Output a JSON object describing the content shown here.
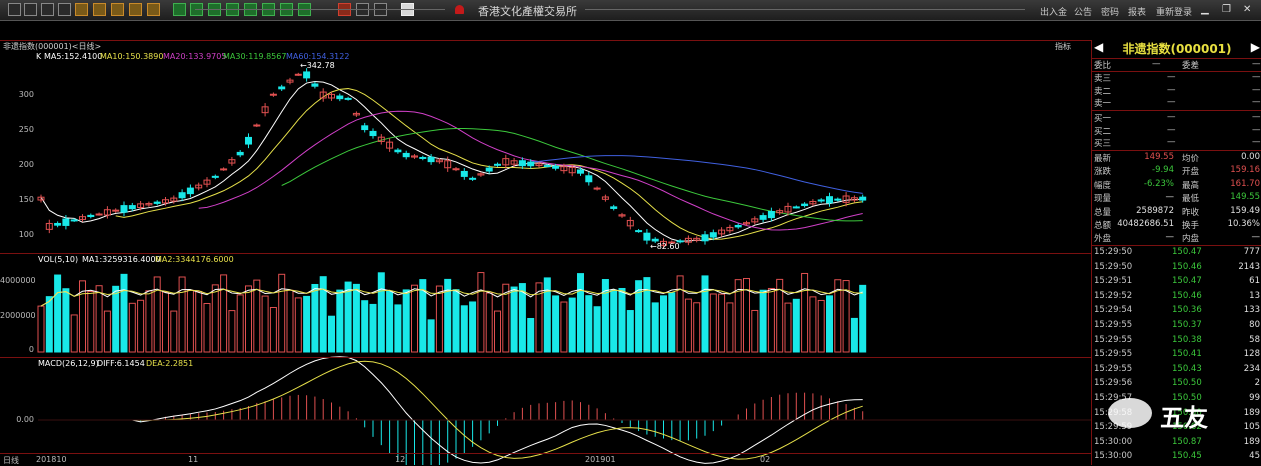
{
  "window": {
    "title": "香港文化產權交易所",
    "menu": [
      "出入金",
      "公告",
      "密码",
      "报表",
      "重新登录"
    ],
    "toolbar_icons": [
      "chart-icon",
      "line-icon",
      "bar-icon",
      "table-icon",
      "select-icon",
      "tool-icon",
      "tool-icon",
      "tool-icon",
      "tool-icon",
      "green-icon",
      "green-icon",
      "green-icon",
      "green-icon",
      "green-icon",
      "green-icon",
      "green-icon",
      "green-icon",
      "report-icon",
      "zoom-in-icon",
      "zoom-out-icon",
      "note-icon"
    ]
  },
  "chart": {
    "header": "非遗指数(000001)<日线>",
    "ma_labels": {
      "k": "K",
      "ma5": "MA5:152.4100",
      "ma10": "MA10:150.3890",
      "ma20": "MA20:133.9705",
      "ma30": "MA30:119.8567",
      "ma60": "MA60:154.3122"
    },
    "tab": "指标",
    "high_mark": "342.78",
    "low_mark": "82.60",
    "vol_label": "VOL(5,10)",
    "vol_ma1": "MA1:3259316.4000",
    "vol_ma2": "MA2:3344176.6000",
    "macd_label": "MACD(26,12,9)",
    "macd_diff": "DIFF:6.1454",
    "macd_dea": "DEA:2.2851",
    "price_ticks": [
      "300",
      "250",
      "200",
      "150",
      "100"
    ],
    "vol_ticks": [
      "4000000",
      "2000000",
      "0"
    ],
    "macd_ticks": [
      "0.00"
    ],
    "x_ticks": [
      "日线",
      "201810",
      "11",
      "12",
      "201901",
      "02"
    ],
    "colors": {
      "up": "#e05050",
      "down": "#19e8e8",
      "ma5": "#ffffff",
      "ma10": "#e6e04a",
      "ma20": "#d040c8",
      "ma30": "#3cc83c",
      "ma60": "#4060e0"
    }
  },
  "chart_data": {
    "type": "candlestick",
    "price_ylim": [
      82.6,
      342.78
    ],
    "note_points": {
      "high": 342.78,
      "low": 82.6
    },
    "volume_ma": {
      "MA1": 3259316.4,
      "MA2": 3344176.6
    },
    "macd": {
      "DIFF": 6.1454,
      "DEA": 2.2851
    }
  },
  "quote": {
    "title": "非遗指数(000001)",
    "weibi": {
      "l1": "委比",
      "v1": "—",
      "l2": "委差",
      "v2": "—"
    },
    "asks": [
      {
        "label": "卖三",
        "p": "—",
        "v": "—"
      },
      {
        "label": "卖二",
        "p": "—",
        "v": "—"
      },
      {
        "label": "卖一",
        "p": "—",
        "v": "—"
      }
    ],
    "bids": [
      {
        "label": "买一",
        "p": "—",
        "v": "—"
      },
      {
        "label": "买二",
        "p": "—",
        "v": "—"
      },
      {
        "label": "买三",
        "p": "—",
        "v": "—"
      }
    ],
    "stats": [
      {
        "l1": "最新",
        "v1": "149.55",
        "l2": "均价",
        "v2": "0.00",
        "c1": "#e05050",
        "c2": "#e0e0e0"
      },
      {
        "l1": "涨跌",
        "v1": "-9.94",
        "l2": "开盘",
        "v2": "159.16",
        "c1": "#3cc83c",
        "c2": "#e05050"
      },
      {
        "l1": "幅度",
        "v1": "-6.23%",
        "l2": "最高",
        "v2": "161.70",
        "c1": "#3cc83c",
        "c2": "#e05050"
      },
      {
        "l1": "现量",
        "v1": "—",
        "l2": "最低",
        "v2": "149.55",
        "c1": "#e0e0e0",
        "c2": "#3cc83c"
      },
      {
        "l1": "总量",
        "v1": "2589872",
        "l2": "昨收",
        "v2": "159.49",
        "c1": "#e0e0e0",
        "c2": "#e0e0e0"
      },
      {
        "l1": "总额",
        "v1": "40482686.51",
        "l2": "换手",
        "v2": "10.36%",
        "c1": "#e0e0e0",
        "c2": "#e0e0e0"
      },
      {
        "l1": "外盘",
        "v1": "—",
        "l2": "内盘",
        "v2": "—",
        "c1": "#e0e0e0",
        "c2": "#e0e0e0"
      }
    ],
    "ticks": [
      {
        "t": "15:29:50",
        "p": "150.47",
        "v": "777"
      },
      {
        "t": "15:29:50",
        "p": "150.46",
        "v": "2143"
      },
      {
        "t": "15:29:51",
        "p": "150.47",
        "v": "61"
      },
      {
        "t": "15:29:52",
        "p": "150.46",
        "v": "13"
      },
      {
        "t": "15:29:54",
        "p": "150.36",
        "v": "133"
      },
      {
        "t": "15:29:55",
        "p": "150.37",
        "v": "80"
      },
      {
        "t": "15:29:55",
        "p": "150.38",
        "v": "58"
      },
      {
        "t": "15:29:55",
        "p": "150.41",
        "v": "128"
      },
      {
        "t": "15:29:55",
        "p": "150.43",
        "v": "234"
      },
      {
        "t": "15:29:56",
        "p": "150.50",
        "v": "2"
      },
      {
        "t": "15:29:57",
        "p": "150.50",
        "v": "99"
      },
      {
        "t": "15:29:58",
        "p": "150.50",
        "v": "189"
      },
      {
        "t": "15:29:59",
        "p": "150.62",
        "v": "105"
      },
      {
        "t": "15:30:00",
        "p": "150.87",
        "v": "189"
      },
      {
        "t": "15:30:00",
        "p": "150.45",
        "v": "45"
      }
    ]
  },
  "watermark": {
    "text": "五友"
  }
}
